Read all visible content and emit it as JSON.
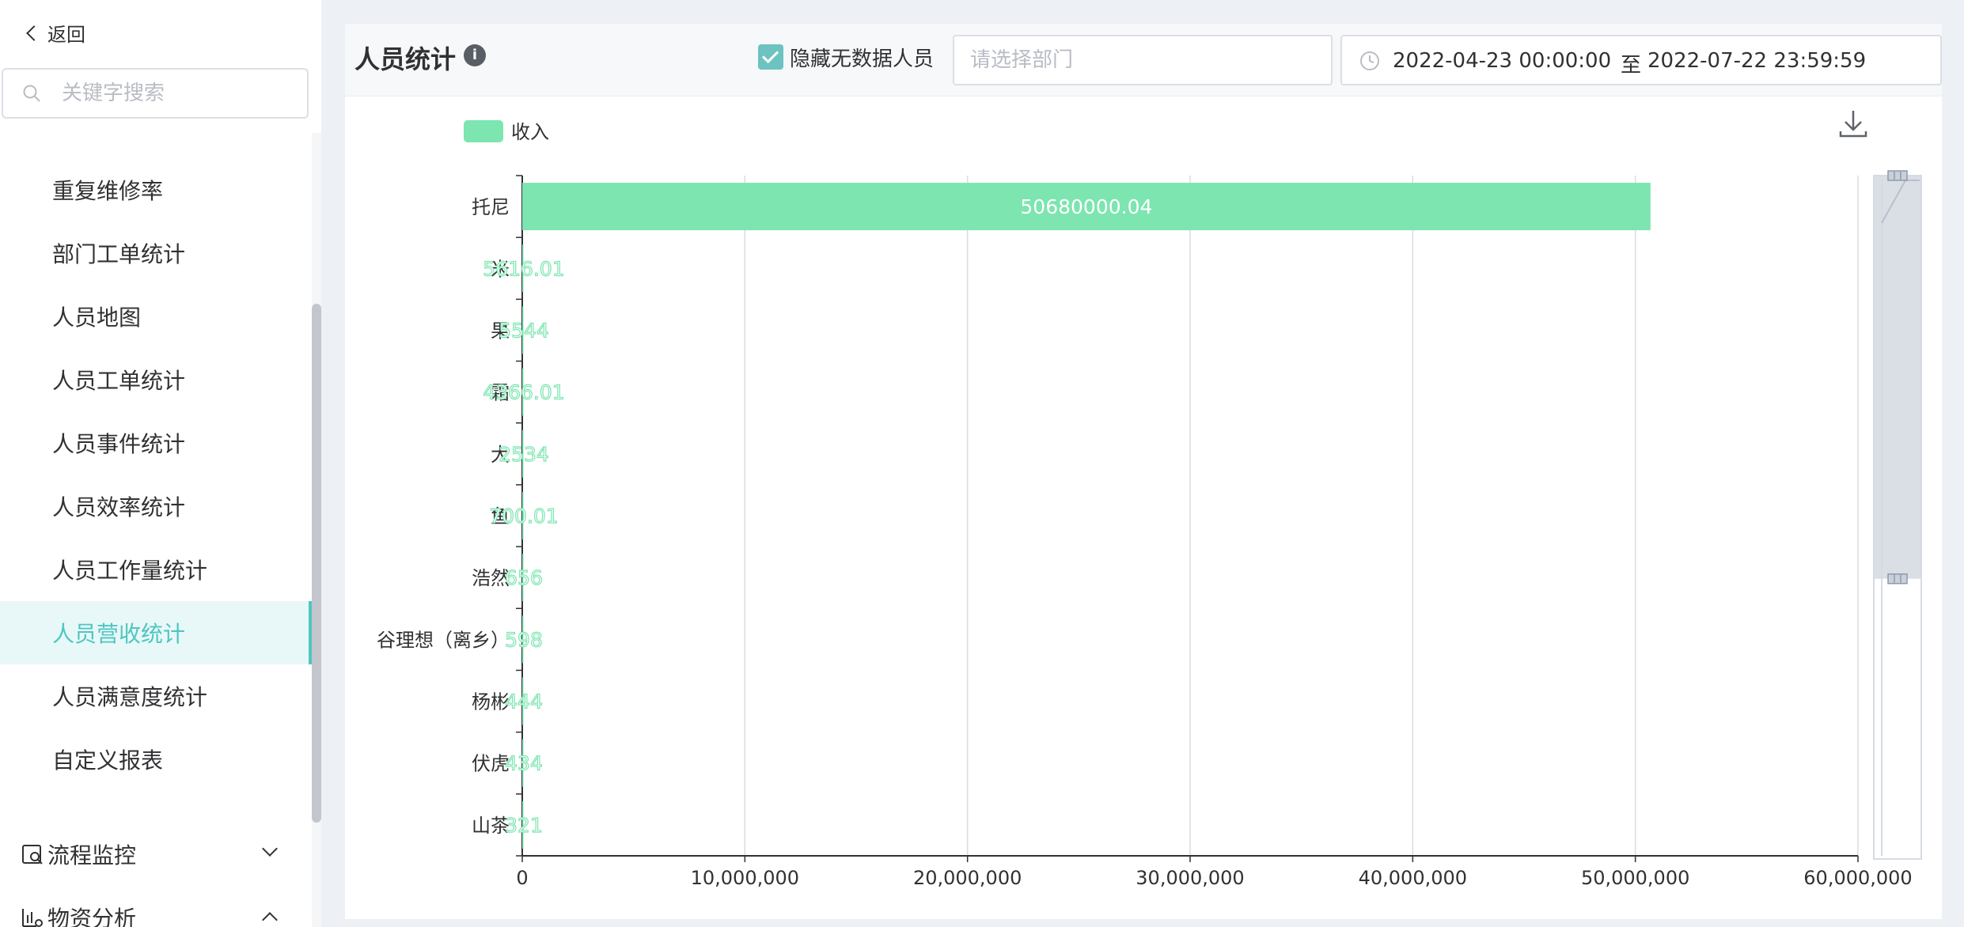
{
  "sidebar": {
    "back_label": "返回",
    "search_placeholder": "关键字搜索",
    "items": [
      {
        "label": "重复维修率"
      },
      {
        "label": "部门工单统计"
      },
      {
        "label": "人员地图"
      },
      {
        "label": "人员工单统计"
      },
      {
        "label": "人员事件统计"
      },
      {
        "label": "人员效率统计"
      },
      {
        "label": "人员工作量统计"
      },
      {
        "label": "人员营收统计",
        "active": true
      },
      {
        "label": "人员满意度统计"
      },
      {
        "label": "自定义报表"
      }
    ],
    "groups": [
      {
        "label": "流程监控",
        "icon": "process-monitor-icon",
        "expanded": false
      },
      {
        "label": "物资分析",
        "icon": "material-analysis-icon",
        "expanded": true
      }
    ]
  },
  "header": {
    "title": "人员统计",
    "hide_empty_label": "隐藏无数据人员",
    "hide_empty_checked": true,
    "dept_placeholder": "请选择部门",
    "date_start": "2022-04-23 00:00:00",
    "date_sep": "至",
    "date_end": "2022-07-22 23:59:59"
  },
  "colors": {
    "accent": "#4fc6c1",
    "bar": "#7ce5b0",
    "checkbox": "#6cc3c0"
  },
  "chart_data": {
    "type": "bar",
    "orientation": "horizontal",
    "legend": [
      "收入"
    ],
    "legend_position": "top-left",
    "categories": [
      "托尼",
      "米",
      "果",
      "霜",
      "大",
      "鱼",
      "浩然",
      "谷理想（离乡）",
      "杨彬",
      "伏虎",
      "山茶"
    ],
    "series": [
      {
        "name": "收入",
        "values": [
          50680000.04,
          5616.01,
          5544,
          4366.01,
          2534,
          700.01,
          656,
          598,
          444,
          434,
          321
        ],
        "labels": [
          "50680000.04",
          "5616.01",
          "5544",
          "4366.01",
          "2534",
          "700.01",
          "656",
          "598",
          "444",
          "434",
          "321"
        ]
      }
    ],
    "xlim": [
      0,
      60000000
    ],
    "xticks": [
      "0",
      "10,000,000",
      "20,000,000",
      "30,000,000",
      "40,000,000",
      "50,000,000",
      "60,000,000"
    ],
    "grid": true,
    "data_zoom": {
      "start": 0,
      "end": 0.59
    }
  }
}
